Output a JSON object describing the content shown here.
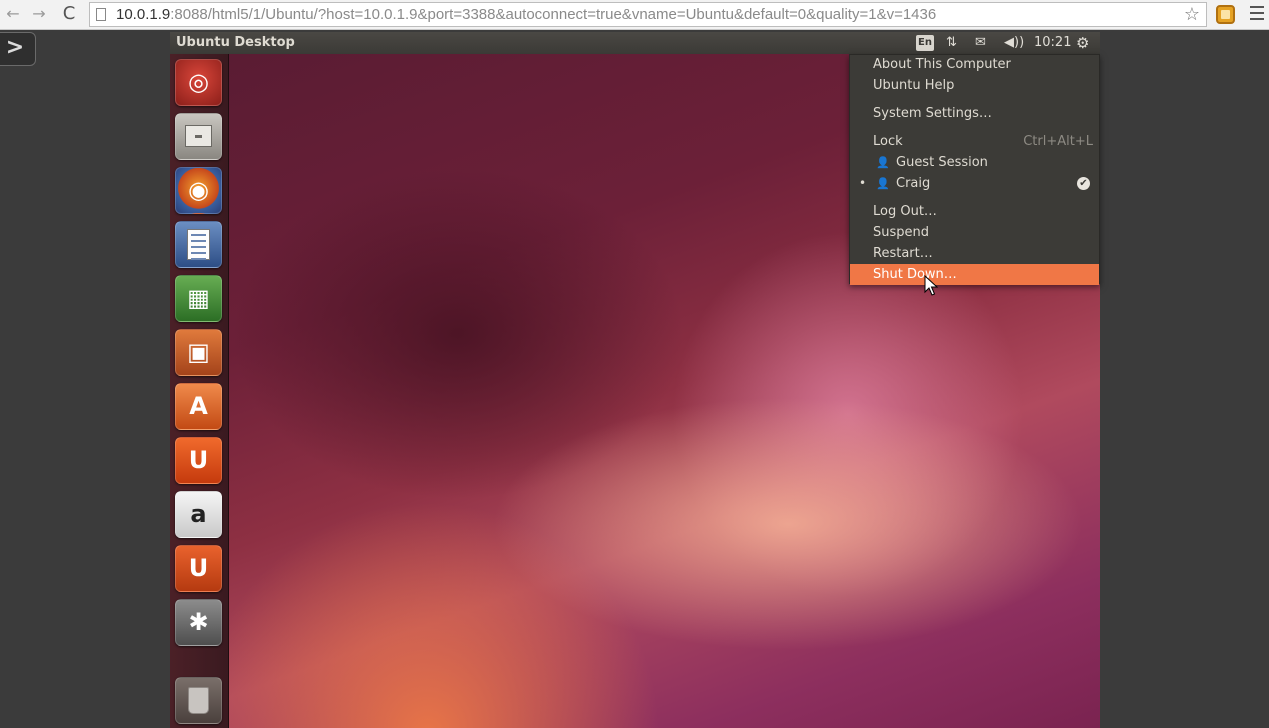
{
  "browser": {
    "url_host": "10.0.1.9",
    "url_rest": ":8088/html5/1/Ubuntu/?host=10.0.1.9&port=3388&autoconnect=true&vname=Ubuntu&default=0&quality=1&v=1436",
    "back_icon": "←",
    "forward_icon": "→",
    "reload_icon": "C",
    "star_icon": "☆"
  },
  "sidebar_toggle": {
    "icon": ">"
  },
  "panel": {
    "title": "Ubuntu Desktop",
    "keyboard": "En",
    "network_icon": "⇅",
    "mail_icon": "✉",
    "sound_icon": "◀))",
    "clock": "10:21",
    "session_icon": "⚙"
  },
  "launcher": {
    "dash_glyph": "◎",
    "firefox_glyph": "◉",
    "calc_glyph": "▦",
    "impress_glyph": "▣",
    "software_glyph": "A",
    "ubuntuone_glyph": "U",
    "amazon_glyph": "a",
    "music_glyph": "U",
    "settings_glyph": "✱"
  },
  "session_menu": {
    "about": "About This Computer",
    "help": "Ubuntu Help",
    "settings": "System Settings…",
    "lock": "Lock",
    "lock_accel": "Ctrl+Alt+L",
    "guest": "Guest Session",
    "user_icon": "👤",
    "user": "Craig",
    "user_bullet": "•",
    "check": "✔",
    "logout": "Log Out…",
    "suspend": "Suspend",
    "restart": "Restart…",
    "shutdown": "Shut Down…"
  }
}
